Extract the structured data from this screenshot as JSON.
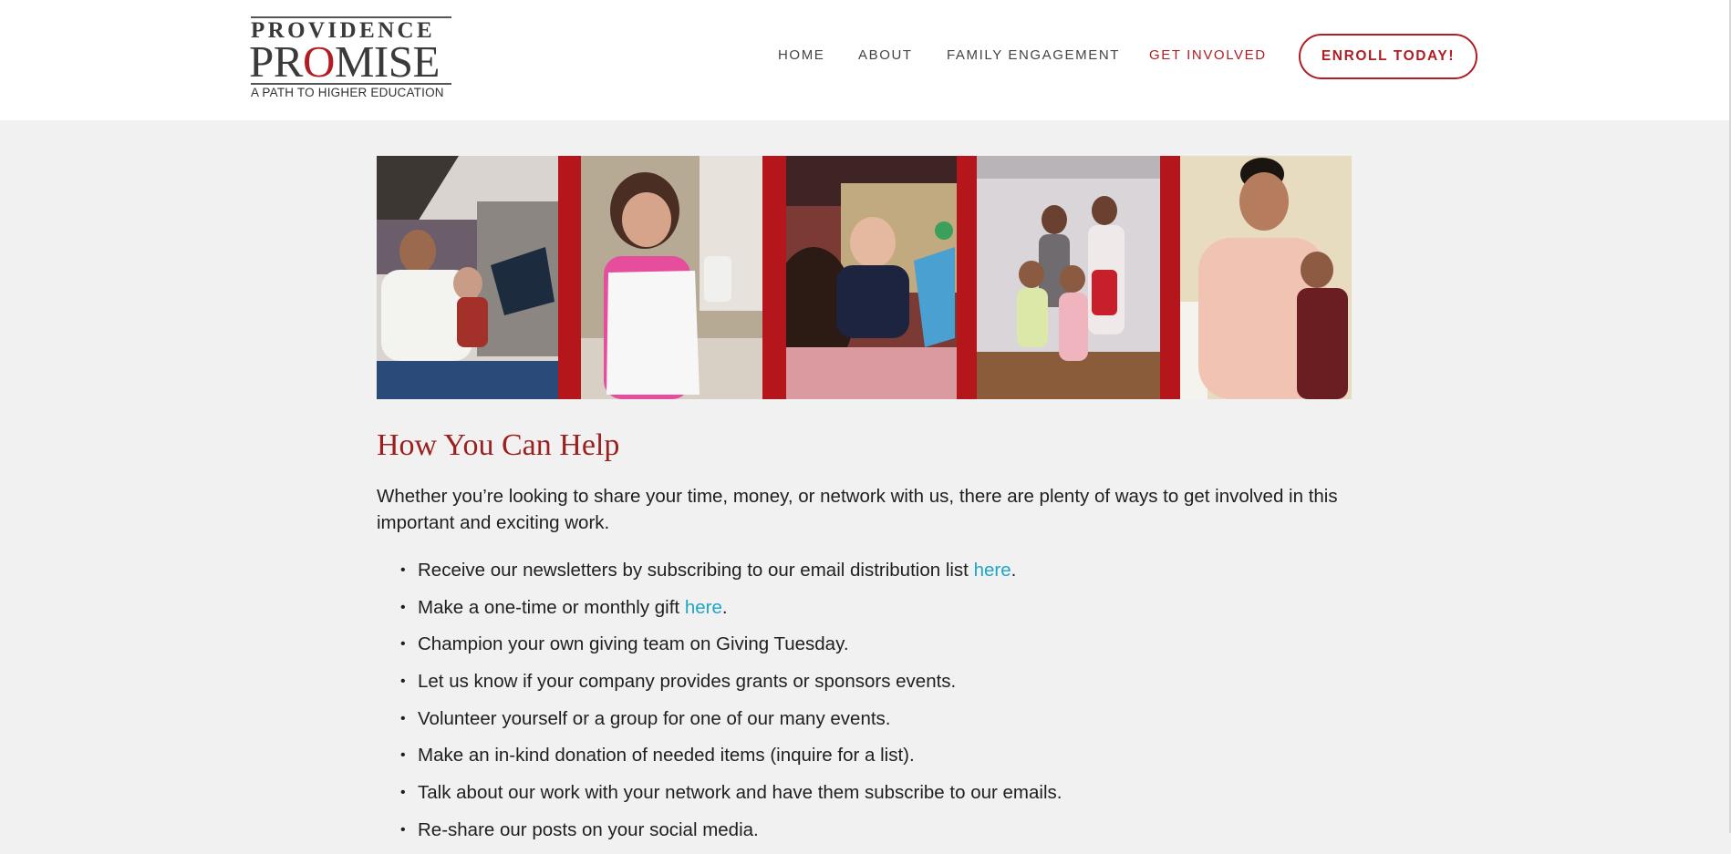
{
  "logo": {
    "line1": "PROVIDENCE",
    "line2_pre": "PR",
    "line2_o": "O",
    "line2_post": "MISE",
    "tagline": "A PATH TO HIGHER EDUCATION"
  },
  "nav": [
    {
      "label": "HOME"
    },
    {
      "label": "ABOUT"
    },
    {
      "label": "FAMILY ENGAGEMENT"
    },
    {
      "label": "GET INVOLVED",
      "active": true
    }
  ],
  "enroll_label": "ENROLL TODAY!",
  "colors": {
    "brand_red": "#b01e23",
    "link": "#1ea6c4",
    "background": "#f1f1f1"
  },
  "gallery": {
    "photos": [
      "man-reading-book-to-toddler",
      "girl-holding-paper",
      "toddler-with-picture-book",
      "four-children-standing",
      "young-man-and-boy"
    ]
  },
  "main": {
    "heading": "How You Can Help",
    "intro": "Whether you’re looking to share your time, money, or network with us, there are plenty of ways to get involved in this important and exciting work.",
    "bullets": [
      {
        "text": "Receive our newsletters by subscribing to our email distribution list ",
        "link": "here",
        "after": "."
      },
      {
        "text": "Make a one-time or monthly gift ",
        "link": "here",
        "after": "."
      },
      {
        "text": "Champion your own giving team on Giving Tuesday."
      },
      {
        "text": "Let us know if your company provides grants or sponsors events."
      },
      {
        "text": "Volunteer yourself or a group for one of our many events."
      },
      {
        "text": "Make an in-kind donation of needed items (inquire for a list)."
      },
      {
        "text": "Talk about our work with your network and have them subscribe to our emails."
      },
      {
        "text": "Re-share our posts on your social media."
      }
    ]
  }
}
